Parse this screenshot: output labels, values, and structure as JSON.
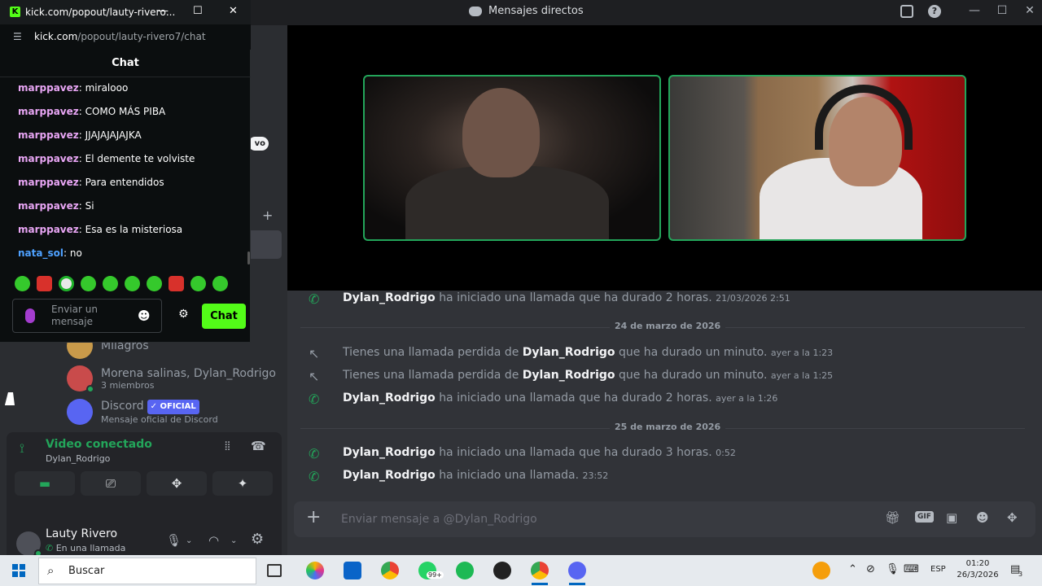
{
  "discord": {
    "window_title": "Mensajes directos",
    "dm_list": [
      {
        "name": "Milagros",
        "sub": "",
        "avatar_color": "#c99a4a"
      },
      {
        "name": "Morena salinas, Dylan_Rodrigo",
        "sub": "3 miembros",
        "avatar_color": "#c94b4b"
      },
      {
        "name": "Discord",
        "badge": "✓ OFICIAL",
        "sub": "Mensaje oficial de Discord",
        "avatar_color": "#5865f2"
      }
    ],
    "sidebar_peek": {
      "pill": "vo",
      "add": "+"
    },
    "voice": {
      "status": "Video conectado",
      "channel": "Dylan_Rodrigo"
    },
    "user": {
      "name": "Lauty Rivero",
      "status": "En una llamada"
    },
    "messages": [
      {
        "type": "call",
        "user": "Dylan_Rodrigo",
        "text": "ha iniciado una llamada que ha durado 2 horas.",
        "time": "21/03/2026 2:51"
      },
      {
        "type": "divider",
        "label": "24 de marzo de 2026"
      },
      {
        "type": "missed",
        "pre": "Tienes una llamada perdida de",
        "user": "Dylan_Rodrigo",
        "text": "que ha durado un minuto.",
        "time": "ayer a la 1:23"
      },
      {
        "type": "missed",
        "pre": "Tienes una llamada perdida de",
        "user": "Dylan_Rodrigo",
        "text": "que ha durado un minuto.",
        "time": "ayer a la 1:25"
      },
      {
        "type": "call",
        "user": "Dylan_Rodrigo",
        "text": "ha iniciado una llamada que ha durado 2 horas.",
        "time": "ayer a la 1:26"
      },
      {
        "type": "divider",
        "label": "25 de marzo de 2026"
      },
      {
        "type": "call",
        "user": "Dylan_Rodrigo",
        "text": "ha iniciado una llamada que ha durado 3 horas.",
        "time": "0:52"
      },
      {
        "type": "call",
        "user": "Dylan_Rodrigo",
        "text": "ha iniciado una llamada.",
        "time": "23:52"
      }
    ],
    "composer_placeholder": "Enviar mensaje a @Dylan_Rodrigo",
    "accent": "#23a55a"
  },
  "kick": {
    "window_title": "kick.com/popout/lauty-riverо...",
    "url_host": "kick.com",
    "url_path": "/popout/lauty-rivero7/chat",
    "header": "Chat",
    "messages": [
      {
        "user": "marppavez",
        "text": "miralooo"
      },
      {
        "user": "marppavez",
        "text": "COMO MÁS PIBA"
      },
      {
        "user": "marppavez",
        "text": "JJAJAJAJAJKA"
      },
      {
        "user": "marppavez",
        "text": "El demente te volviste"
      },
      {
        "user": "marppavez",
        "text": "Para entendidos"
      },
      {
        "user": "marppavez",
        "text": "Si"
      },
      {
        "user": "marppavez",
        "text": "Esa es la misteriosa"
      },
      {
        "user": "nata_sol",
        "text": "no",
        "user_color": "blue"
      }
    ],
    "input_placeholder": "Enviar un mensaje",
    "send_label": "Chat",
    "brand_color": "#53fc18"
  },
  "taskbar": {
    "search_placeholder": "Buscar",
    "whatsapp_badge": "99+",
    "language": "ESP",
    "time": "01:20",
    "date": "26/3/2026",
    "notification_count": "3"
  }
}
